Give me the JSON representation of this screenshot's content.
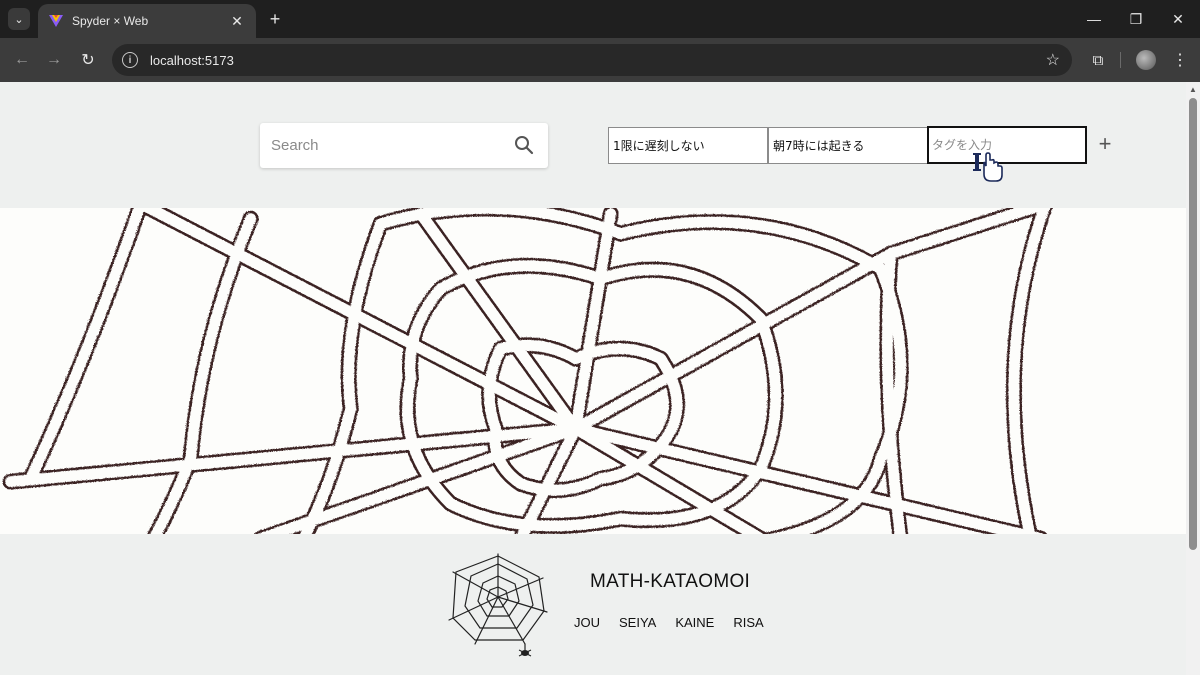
{
  "browser": {
    "tab_title": "Spyder × Web",
    "url": "localhost:5173",
    "colors": {
      "chrome_dark": "#1f1f1f",
      "chrome_toolbar": "#3c3c3c"
    }
  },
  "header": {
    "search_placeholder": "Search",
    "tags": [
      {
        "label": "1限に遅刻しない"
      },
      {
        "label": "朝7時には起きる"
      }
    ],
    "tag_input_placeholder": "タグを入力",
    "add_label": "+"
  },
  "footer": {
    "brand": "MATH-KATAOMOI",
    "members": [
      "JOU",
      "SEIYA",
      "KAINE",
      "RISA"
    ]
  }
}
